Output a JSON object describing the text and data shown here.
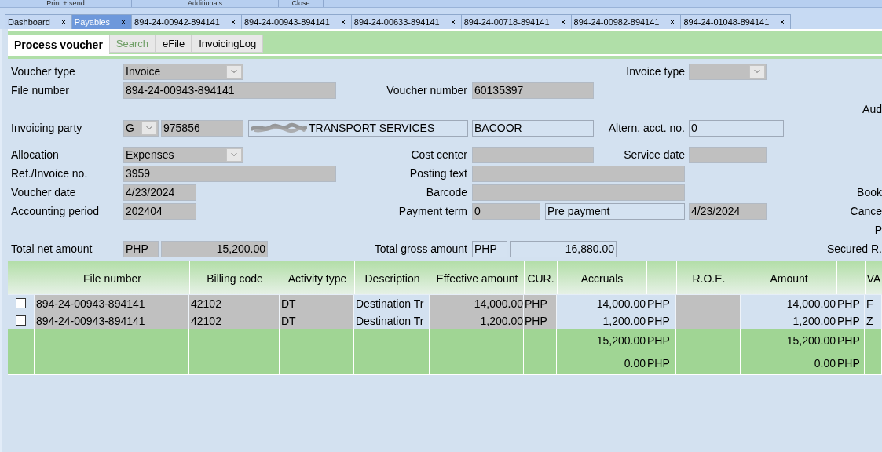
{
  "ribbon": {
    "groups": [
      "Print + send",
      "Additionals",
      "Close"
    ]
  },
  "document_tabs": [
    {
      "label": "Dashboard",
      "selected": false
    },
    {
      "label": "Payables",
      "selected": true
    },
    {
      "label": "894-24-00942-894141",
      "selected": false
    },
    {
      "label": "894-24-00943-894141",
      "selected": false
    },
    {
      "label": "894-24-00633-894141",
      "selected": false
    },
    {
      "label": "894-24-00718-894141",
      "selected": false
    },
    {
      "label": "894-24-00982-894141",
      "selected": false
    },
    {
      "label": "894-24-01048-894141",
      "selected": false
    }
  ],
  "view_tabs": [
    {
      "label": "Process voucher",
      "selected": true,
      "disabled": false
    },
    {
      "label": "Search",
      "selected": false,
      "disabled": true
    },
    {
      "label": "eFile",
      "selected": false,
      "disabled": false
    },
    {
      "label": "InvoicingLog",
      "selected": false,
      "disabled": false
    }
  ],
  "form": {
    "voucher_type": {
      "label": "Voucher type",
      "value": "Invoice",
      "readonly": true
    },
    "invoice_type": {
      "label": "Invoice type",
      "readonly": true
    },
    "file_number": {
      "label": "File number",
      "value": "894-24-00943-894141",
      "readonly": true
    },
    "voucher_number": {
      "label": "Voucher number",
      "value": "60135397",
      "readonly": true
    },
    "invoicing_party": {
      "label": "Invoicing party",
      "party_type": {
        "value": "G",
        "readonly": true
      },
      "account": {
        "value": "975856",
        "readonly": true
      },
      "name": {
        "value": "TRANSPORT SERVICES",
        "readonly": false,
        "redacted": true
      },
      "city": {
        "value": "BACOOR",
        "readonly": false
      }
    },
    "alternate_account": {
      "label": "Altern. acct. no.",
      "value": "0",
      "readonly": false
    },
    "allocation": {
      "label": "Allocation",
      "value": "Expenses",
      "readonly": true
    },
    "cost_center": {
      "label": "Cost center",
      "readonly": true
    },
    "service_date": {
      "label": "Service date",
      "readonly": true
    },
    "ref_invoice_no": {
      "label": "Ref./Invoice no.",
      "value": "3959",
      "readonly": true
    },
    "posting_text": {
      "label": "Posting text",
      "readonly": true
    },
    "voucher_date": {
      "label": "Voucher date",
      "value": "4/23/2024",
      "readonly": true
    },
    "barcode": {
      "label": "Barcode",
      "readonly": true
    },
    "accounting_period": {
      "label": "Accounting period",
      "value": "202404",
      "readonly": true
    },
    "payment_term": {
      "label": "Payment term",
      "days": {
        "value": "0",
        "readonly": true
      },
      "description": {
        "value": "Pre payment",
        "readonly": false
      },
      "due_date": {
        "value": "4/23/2024",
        "readonly": true
      }
    },
    "total_net_amount": {
      "label": "Total net amount",
      "currency": {
        "value": "PHP",
        "readonly": true
      },
      "amount": {
        "value": "15,200.00",
        "readonly": true
      }
    },
    "total_gross_amount": {
      "label": "Total gross amount",
      "currency": {
        "value": "PHP",
        "readonly": false
      },
      "amount": {
        "value": "16,880.00",
        "readonly": false
      }
    },
    "side_labels": [
      "Aud",
      "Book",
      "Cance",
      "P",
      "Secured R."
    ]
  },
  "grid": {
    "columns": [
      {
        "label": "File number",
        "kind": "text",
        "readonly": true
      },
      {
        "label": "Billing code",
        "kind": "text",
        "readonly": true
      },
      {
        "label": "Activity type",
        "kind": "text",
        "readonly": true
      },
      {
        "label": "Description",
        "kind": "text",
        "readonly": false
      },
      {
        "label": "Effective amount",
        "kind": "amount",
        "readonly": true
      },
      {
        "label": "CUR.",
        "kind": "currency",
        "readonly": true
      },
      {
        "label": "Accruals",
        "kind": "amount",
        "readonly": false
      },
      {
        "kind": "currency",
        "readonly": false
      },
      {
        "label": "R.O.E.",
        "kind": "amount",
        "readonly": true
      },
      {
        "label": "Amount",
        "kind": "amount",
        "readonly": false
      },
      {
        "kind": "currency",
        "readonly": false
      },
      {
        "label": "VA",
        "kind": "text",
        "readonly": false
      }
    ],
    "rows": [
      {
        "checked": false,
        "cells": [
          "894-24-00943-894141",
          "42102",
          "DT",
          "Destination Tr",
          "14,000.00",
          "PHP",
          "14,000.00",
          "PHP",
          null,
          "14,000.00",
          "PHP",
          "F"
        ]
      },
      {
        "checked": false,
        "cells": [
          "894-24-00943-894141",
          "42102",
          "DT",
          "Destination Tr",
          "1,200.00",
          "PHP",
          "1,200.00",
          "PHP",
          null,
          "1,200.00",
          "PHP",
          "Z"
        ]
      }
    ],
    "totals": [
      {
        "cells": [
          null,
          null,
          null,
          null,
          null,
          null,
          "15,200.00",
          "PHP",
          null,
          "15,200.00",
          "PHP",
          null
        ]
      },
      {
        "cells": [
          null,
          null,
          null,
          null,
          null,
          null,
          "0.00",
          "PHP",
          null,
          "0.00",
          "PHP",
          null
        ]
      }
    ]
  }
}
